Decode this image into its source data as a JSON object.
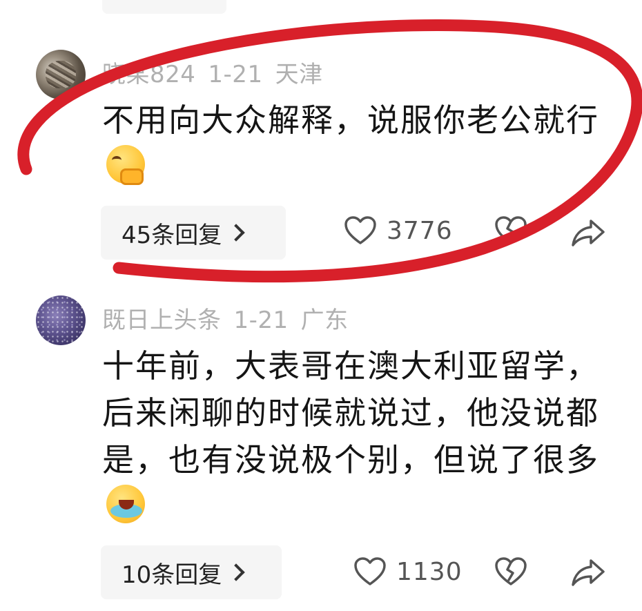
{
  "comments": [
    {
      "username": "晓某824",
      "date": "1-21",
      "location": "天津",
      "text": "不用向大众解释，说服你老公就行",
      "emoji": "thinking-face-emoji",
      "replies_label": "45条回复",
      "like_count": "3776"
    },
    {
      "username": "既日上头条",
      "date": "1-21",
      "location": "广东",
      "text": "十年前，大表哥在澳大利亚留学，后来闲聊的时候就说过，他没说都是，也有没说极个别，但说了很多",
      "emoji": "loudly-crying-face-emoji",
      "replies_label": "10条回复",
      "like_count": "1130"
    }
  ],
  "icons": {
    "like": "heart-icon",
    "dislike": "broken-heart-icon",
    "share": "share-arrow-icon",
    "reply_chevron": "chevron-right-icon"
  },
  "colors": {
    "annotation": "#d8202a",
    "meta_text": "#b0b0b0",
    "body_text": "#151515",
    "pill_bg": "#f5f5f5"
  }
}
